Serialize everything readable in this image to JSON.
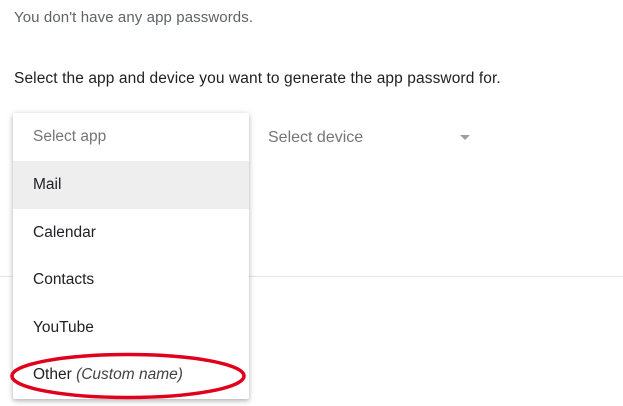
{
  "status": {
    "no_passwords_text": "You don't have any app passwords."
  },
  "instruction": {
    "text": "Select the app and device you want to generate the app password for."
  },
  "app_select": {
    "placeholder": "Select app",
    "options": [
      {
        "label": "Mail",
        "selected": true
      },
      {
        "label": "Calendar",
        "selected": false
      },
      {
        "label": "Contacts",
        "selected": false
      },
      {
        "label": "YouTube",
        "selected": false
      },
      {
        "label": "Other",
        "suffix": "(Custom name)",
        "selected": false
      }
    ]
  },
  "device_select": {
    "placeholder": "Select device",
    "icon": "chevron-down-icon"
  },
  "annotation": {
    "color": "#e0001b",
    "target": "Other (Custom name)"
  },
  "colors": {
    "selected_background": "#eeeeee",
    "placeholder_text": "#757575",
    "primary_text": "#202124"
  }
}
